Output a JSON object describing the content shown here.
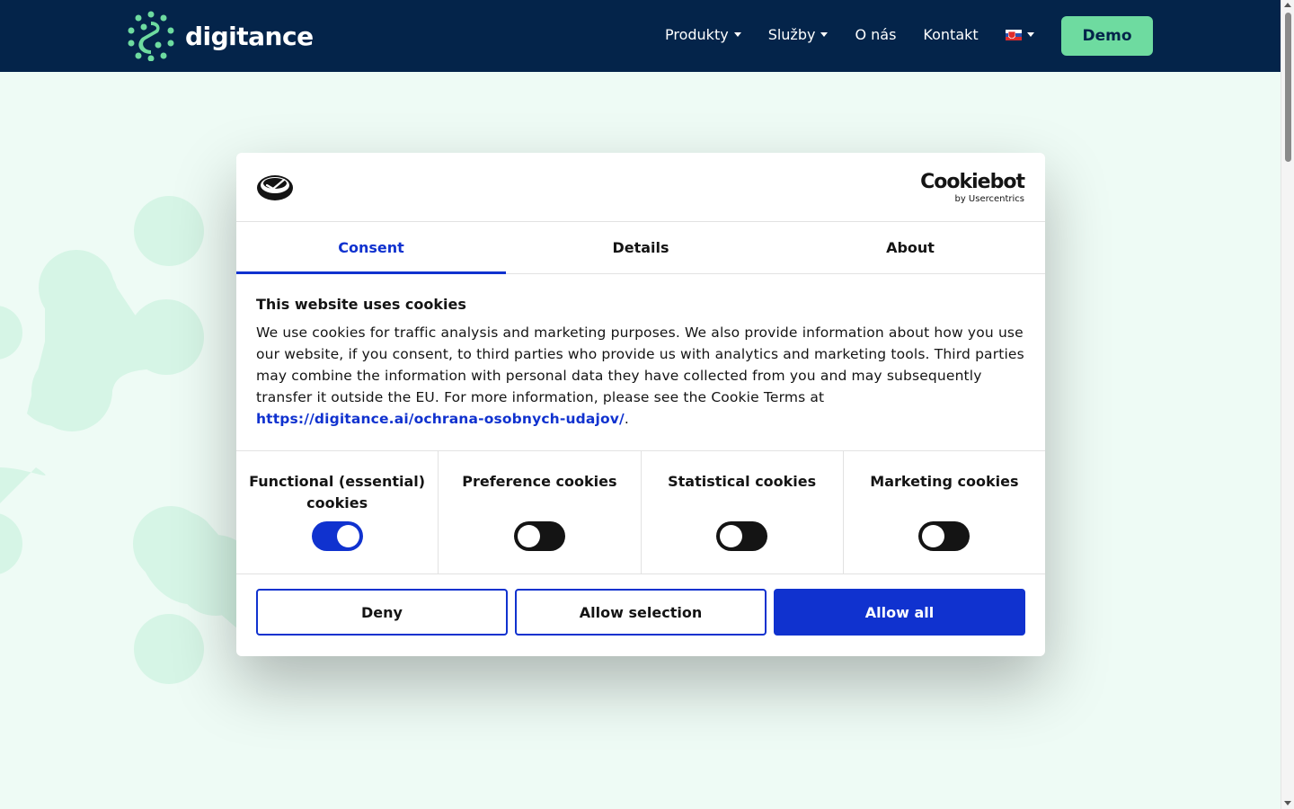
{
  "header": {
    "logo_text": "digitance",
    "nav": [
      {
        "label": "Produkty",
        "has_dropdown": true
      },
      {
        "label": "Služby",
        "has_dropdown": true
      },
      {
        "label": "O nás",
        "has_dropdown": false
      },
      {
        "label": "Kontakt",
        "has_dropdown": false
      }
    ],
    "language_icon": "slovak-flag-icon",
    "demo_label": "Demo"
  },
  "colors": {
    "header_bg": "#04244a",
    "accent_green": "#6edba0",
    "cookiebot_blue": "#1032cf",
    "page_bg": "#eefbf5"
  },
  "cookie_dialog": {
    "brand": {
      "name": "Cookiebot",
      "sub": "by Usercentrics"
    },
    "tabs": [
      {
        "label": "Consent",
        "active": true
      },
      {
        "label": "Details",
        "active": false
      },
      {
        "label": "About",
        "active": false
      }
    ],
    "title": "This website uses cookies",
    "text": "We use cookies for traffic analysis and marketing purposes. We also provide information about how you use our website, if you consent, to third parties who provide us with analytics and marketing tools. Third parties may combine the information with personal data they have collected from you and may subsequently transfer it outside the EU. For more information, please see the Cookie Terms at ",
    "link": "https://digitance.ai/ochrana-osobnych-udajov/",
    "text_end": ".",
    "categories": [
      {
        "label": "Functional (essential) cookies",
        "enabled": true
      },
      {
        "label": "Preference cookies",
        "enabled": false
      },
      {
        "label": "Statistical cookies",
        "enabled": false
      },
      {
        "label": "Marketing cookies",
        "enabled": false
      }
    ],
    "buttons": {
      "deny": "Deny",
      "allow_selection": "Allow selection",
      "allow_all": "Allow all"
    }
  }
}
